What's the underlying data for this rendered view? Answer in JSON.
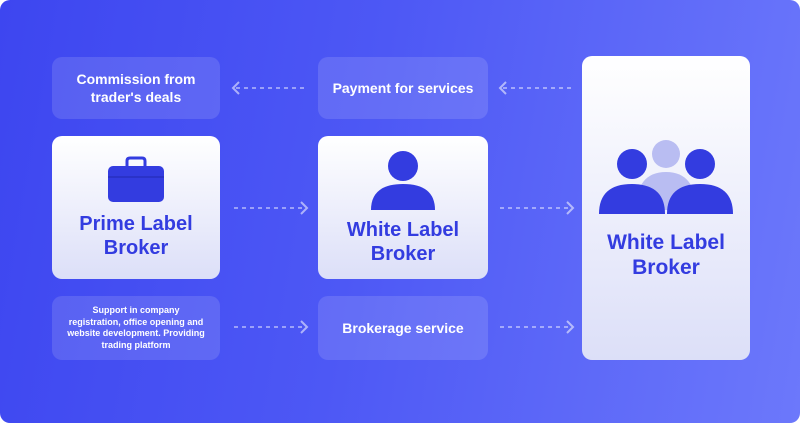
{
  "top_row": {
    "commission": "Commission from trader's deals",
    "payment": "Payment for services"
  },
  "cards": {
    "prime": {
      "line1": "Prime Label",
      "line2": "Broker",
      "icon": "briefcase-icon"
    },
    "white_single": {
      "line1": "White Label",
      "line2": "Broker",
      "icon": "person-icon"
    },
    "white_group": {
      "line1": "White Label",
      "line2": "Broker",
      "icon": "group-icon"
    }
  },
  "bottom_row": {
    "support": "Support in company registration, office opening and website development. Providing trading platform",
    "brokerage": "Brokerage service"
  },
  "colors": {
    "background_start": "#3d46f0",
    "background_end": "#6c78fb",
    "accent": "#333ce0",
    "icon_light": "#b9bdf2"
  }
}
